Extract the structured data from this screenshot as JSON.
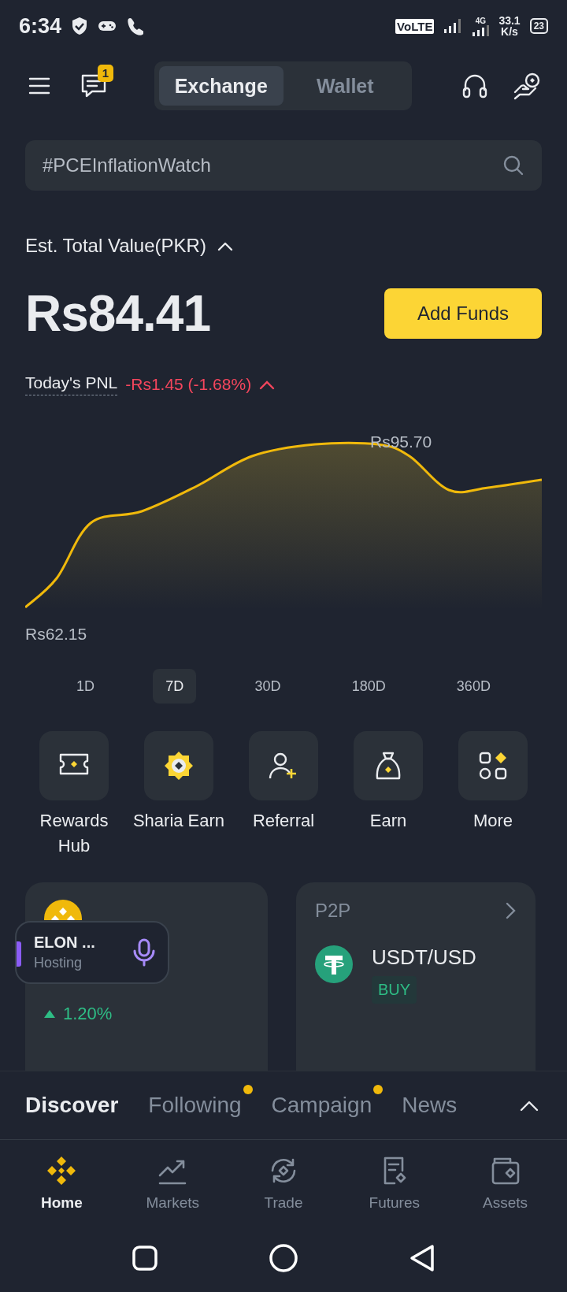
{
  "status_bar": {
    "time": "6:34",
    "volte": "VoLTE",
    "network": "4G",
    "speed": "33.1",
    "speed_unit": "K/s",
    "battery": "23"
  },
  "header": {
    "notification_count": "1",
    "segments": [
      {
        "label": "Exchange",
        "selected": true
      },
      {
        "label": "Wallet",
        "selected": false
      }
    ]
  },
  "search": {
    "placeholder": "#PCEInflationWatch"
  },
  "balance": {
    "label": "Est. Total Value(PKR)",
    "value": "Rs84.41",
    "button": "Add Funds"
  },
  "pnl": {
    "label": "Today's PNL",
    "value": "-Rs1.45 (-1.68%)"
  },
  "chart": {
    "high_label": "Rs95.70",
    "low_label": "Rs62.15"
  },
  "ranges": [
    {
      "label": "1D",
      "selected": false
    },
    {
      "label": "7D",
      "selected": true
    },
    {
      "label": "30D",
      "selected": false
    },
    {
      "label": "180D",
      "selected": false
    },
    {
      "label": "360D",
      "selected": false
    }
  ],
  "actions": [
    {
      "kind": "ticket",
      "label": "Rewards Hub"
    },
    {
      "kind": "badge",
      "label": "Sharia Earn"
    },
    {
      "kind": "referral",
      "label": "Referral"
    },
    {
      "kind": "bag",
      "label": "Earn"
    },
    {
      "kind": "grid",
      "label": "More"
    }
  ],
  "coin_card": {
    "change": "1.20%"
  },
  "p2p_card": {
    "title": "P2P",
    "pair": "USDT/USD",
    "tag": "BUY"
  },
  "live_pill": {
    "title": "ELON ...",
    "status": "Hosting"
  },
  "feed_tabs": [
    {
      "label": "Discover",
      "selected": true,
      "dot": false
    },
    {
      "label": "Following",
      "selected": false,
      "dot": true
    },
    {
      "label": "Campaign",
      "selected": false,
      "dot": true
    },
    {
      "label": "News",
      "selected": false,
      "dot": false
    }
  ],
  "nav": [
    {
      "kind": "home",
      "label": "Home",
      "selected": true
    },
    {
      "kind": "markets",
      "label": "Markets",
      "selected": false
    },
    {
      "kind": "trade",
      "label": "Trade",
      "selected": false
    },
    {
      "kind": "futures",
      "label": "Futures",
      "selected": false
    },
    {
      "kind": "assets",
      "label": "Assets",
      "selected": false
    }
  ]
}
